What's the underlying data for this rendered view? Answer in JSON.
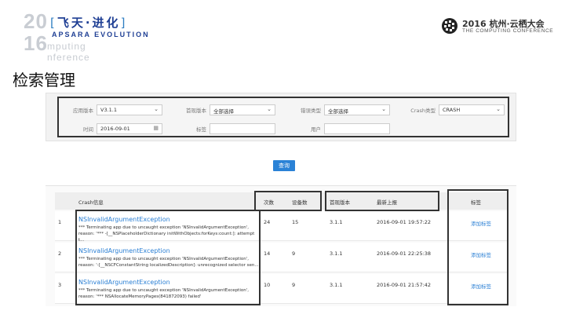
{
  "header": {
    "year_top": "20",
    "year_bottom": "16",
    "evolution_cn": "飞天·进化",
    "evolution_en": "APSARA EVOLUTION",
    "faded_line1": "mputing",
    "faded_line2": "nference",
    "conf_title": "2016 杭州·云栖大会",
    "conf_subtitle": "THE COMPUTING CONFERENCE"
  },
  "page_title": "检索管理",
  "filters": {
    "app_version": {
      "label": "应用版本",
      "value": "V3.1.1"
    },
    "first_version": {
      "label": "首现版本",
      "value": "全部选择"
    },
    "error_type": {
      "label": "错误类型",
      "value": "全部选择"
    },
    "crash_type": {
      "label": "Crash类型",
      "value": "CRASH"
    },
    "time": {
      "label": "时间",
      "value": "2016-09-01"
    },
    "tag": {
      "label": "标签",
      "value": ""
    },
    "user": {
      "label": "用户",
      "value": ""
    }
  },
  "query_button": "查询",
  "table": {
    "columns": {
      "crash_info": "Crash信息",
      "count": "次数",
      "devices": "设备数",
      "first_version": "首现版本",
      "latest_report": "最新上报",
      "tag": "标签"
    },
    "rows": [
      {
        "index": "1",
        "title": "NSInvalidArgumentException",
        "desc": "*** Terminating app due to uncaught exception 'NSInvalidArgumentException', reason: '*** -[__NSPlaceholderDictionary initWithObjects:forKeys:count:]: attempt t...",
        "count": "24",
        "devices": "15",
        "version": "3.1.1",
        "latest": "2016-09-01 19:57:22",
        "action": "添加标签"
      },
      {
        "index": "2",
        "title": "NSInvalidArgumentException",
        "desc": "*** Terminating app due to uncaught exception 'NSInvalidArgumentException', reason: '-[__NSCFConstantString localizedDescription]: unrecognized selector sen...",
        "count": "14",
        "devices": "9",
        "version": "3.1.1",
        "latest": "2016-09-01 22:25:38",
        "action": "添加标签"
      },
      {
        "index": "3",
        "title": "NSInvalidArgumentException",
        "desc": "*** Terminating app due to uncaught exception 'NSInvalidArgumentException', reason: '*** NSAllocateMemoryPages(841872093) failed'",
        "count": "10",
        "devices": "9",
        "version": "3.1.1",
        "latest": "2016-09-01 21:57:42",
        "action": "添加标签"
      }
    ]
  },
  "colors": {
    "link": "#2a7fd4",
    "button": "#2a82d6",
    "highlight_border": "#333333"
  }
}
